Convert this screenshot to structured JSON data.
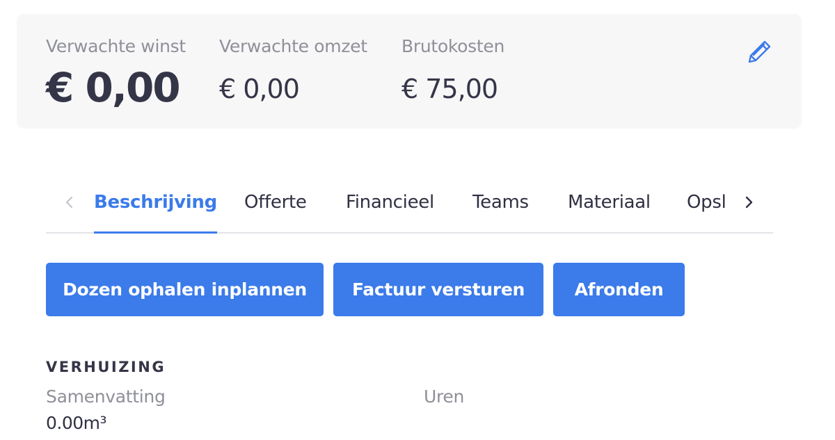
{
  "summary": {
    "metrics": [
      {
        "label": "Verwachte winst",
        "value": "€ 0,00"
      },
      {
        "label": "Verwachte omzet",
        "value": "€ 0,00"
      },
      {
        "label": "Brutokosten",
        "value": "€ 75,00"
      }
    ],
    "edit_icon": "pencil-icon"
  },
  "tabs": {
    "items": [
      {
        "label": "Beschrijving",
        "active": true
      },
      {
        "label": "Offerte"
      },
      {
        "label": "Financieel"
      },
      {
        "label": "Teams"
      },
      {
        "label": "Materiaal"
      },
      {
        "label": "Opslag"
      }
    ],
    "prev_icon": "chevron-left-icon",
    "next_icon": "chevron-right-icon"
  },
  "actions": {
    "schedule_pickup": "Dozen ophalen inplannen",
    "send_invoice": "Factuur versturen",
    "finish": "Afronden"
  },
  "moving": {
    "heading": "VERHUIZING",
    "summary_label": "Samenvatting",
    "hours_label": "Uren",
    "summary_value": "0.00m³"
  },
  "colors": {
    "accent": "#3b7bea",
    "card_background": "#f7f7f8",
    "muted_text": "#8f9098",
    "text": "#2f3042"
  }
}
